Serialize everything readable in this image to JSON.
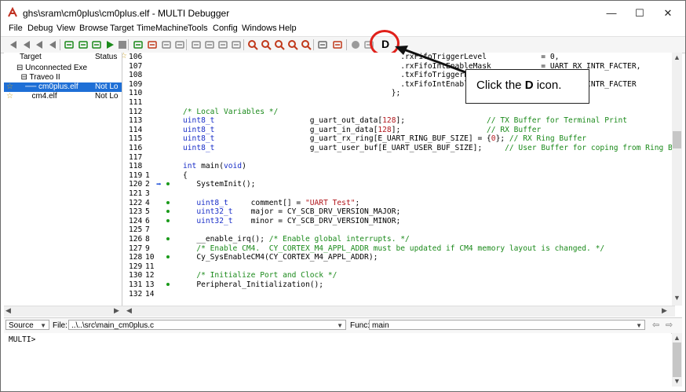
{
  "window": {
    "title": "ghs\\sram\\cm0plus\\cm0plus.elf - MULTI Debugger",
    "minimize_glyph": "—",
    "maximize_glyph": "☐",
    "close_glyph": "✕"
  },
  "menu": [
    "File",
    "Debug",
    "View",
    "Browse",
    "Target",
    "TimeMachine",
    "Tools",
    "Config",
    "Windows",
    "Help"
  ],
  "toolbar": {
    "d_button_label": "D",
    "icons": [
      "back-icon",
      "step-back-icon",
      "step-back2-icon",
      "step-back3-icon",
      "step-over-icon",
      "step-into-icon",
      "step-out-icon",
      "run-icon",
      "stop-icon",
      "restart-icon",
      "download-icon",
      "breakpoint-icon",
      "trace-icon",
      "memory-icon",
      "registers-icon",
      "call-stack-icon",
      "profile-icon",
      "zoom1-icon",
      "zoom2-icon",
      "zoom3-icon",
      "zoom4-icon",
      "zoom5-icon",
      "windows-icon",
      "calc-icon",
      "hand-icon",
      "record-icon"
    ]
  },
  "target_panel": {
    "header_target": "Target",
    "header_status": "Status",
    "rows": [
      {
        "label": "⊟ Unconnected Exe",
        "status": ""
      },
      {
        "label": "  ⊟ Traveo II",
        "status": ""
      },
      {
        "label": "    ── cm0plus.elf",
        "status": "Not Lo",
        "selected": true
      },
      {
        "label": "       cm4.elf",
        "status": "Not Lo",
        "selected": false
      }
    ]
  },
  "source_lines": [
    {
      "ln": "106",
      "ln2": "",
      "dot": false,
      "parts": [
        {
          "t": "                                                .rxFifoTriggerLevel            = 0,",
          "c": ""
        }
      ]
    },
    {
      "ln": "107",
      "ln2": "",
      "dot": false,
      "parts": [
        {
          "t": "                                                .rxFifoIntEnableMask           = UART_RX_INTR_FACTER,",
          "c": ""
        }
      ]
    },
    {
      "ln": "108",
      "ln2": "",
      "dot": false,
      "parts": [
        {
          "t": "                                                .txFifoTriggerLevel",
          "c": ""
        }
      ]
    },
    {
      "ln": "109",
      "ln2": "",
      "dot": false,
      "parts": [
        {
          "t": "                                                .txFifoIntEnableMask           = UART_TX_INTR_FACTER",
          "c": ""
        }
      ]
    },
    {
      "ln": "110",
      "ln2": "",
      "dot": false,
      "parts": [
        {
          "t": "                                              };",
          "c": ""
        }
      ]
    },
    {
      "ln": "111",
      "ln2": "",
      "dot": false,
      "parts": [
        {
          "t": "",
          "c": ""
        }
      ]
    },
    {
      "ln": "112",
      "ln2": "",
      "dot": false,
      "parts": [
        {
          "t": "/* Local Variables */",
          "c": "cm"
        }
      ]
    },
    {
      "ln": "113",
      "ln2": "",
      "dot": false,
      "parts": [
        {
          "t": "uint8_t",
          "c": "kw"
        },
        {
          "t": "                     g_uart_out_data[",
          "c": ""
        },
        {
          "t": "128",
          "c": "st"
        },
        {
          "t": "];                  ",
          "c": ""
        },
        {
          "t": "// TX Buffer for Terminal Print",
          "c": "cm"
        }
      ]
    },
    {
      "ln": "114",
      "ln2": "",
      "dot": false,
      "parts": [
        {
          "t": "uint8_t",
          "c": "kw"
        },
        {
          "t": "                     g_uart_in_data[",
          "c": ""
        },
        {
          "t": "128",
          "c": "st"
        },
        {
          "t": "];                   ",
          "c": ""
        },
        {
          "t": "// RX Buffer",
          "c": "cm"
        }
      ]
    },
    {
      "ln": "115",
      "ln2": "",
      "dot": false,
      "parts": [
        {
          "t": "uint8_t",
          "c": "kw"
        },
        {
          "t": "                     g_uart_rx_ring[E_UART_RING_BUF_SIZE] = {",
          "c": ""
        },
        {
          "t": "0",
          "c": "st"
        },
        {
          "t": "}; ",
          "c": ""
        },
        {
          "t": "// RX Ring Buffer",
          "c": "cm"
        }
      ]
    },
    {
      "ln": "116",
      "ln2": "",
      "dot": false,
      "parts": [
        {
          "t": "uint8_t",
          "c": "kw"
        },
        {
          "t": "                     g_uart_user_buf[E_UART_USER_BUF_SIZE];     ",
          "c": ""
        },
        {
          "t": "// User Buffer for coping from Ring Buffer",
          "c": "cm"
        }
      ]
    },
    {
      "ln": "117",
      "ln2": "",
      "dot": false,
      "parts": [
        {
          "t": "",
          "c": ""
        }
      ]
    },
    {
      "ln": "118",
      "ln2": "",
      "dot": false,
      "parts": [
        {
          "t": "int",
          "c": "kw"
        },
        {
          "t": " main(",
          "c": ""
        },
        {
          "t": "void",
          "c": "kw"
        },
        {
          "t": ")",
          "c": ""
        }
      ]
    },
    {
      "ln": "119",
      "ln2": "1",
      "dot": false,
      "parts": [
        {
          "t": "{",
          "c": ""
        }
      ]
    },
    {
      "ln": "120",
      "ln2": "2",
      "dot": true,
      "pc": true,
      "parts": [
        {
          "t": "   SystemInit();",
          "c": ""
        }
      ]
    },
    {
      "ln": "121",
      "ln2": "3",
      "dot": false,
      "parts": [
        {
          "t": "",
          "c": ""
        }
      ]
    },
    {
      "ln": "122",
      "ln2": "4",
      "dot": true,
      "parts": [
        {
          "t": "   ",
          "c": ""
        },
        {
          "t": "uint8_t",
          "c": "kw"
        },
        {
          "t": "     comment[] = ",
          "c": ""
        },
        {
          "t": "\"UART Test\"",
          "c": "st"
        },
        {
          "t": ";",
          "c": ""
        }
      ]
    },
    {
      "ln": "123",
      "ln2": "5",
      "dot": true,
      "parts": [
        {
          "t": "   ",
          "c": ""
        },
        {
          "t": "uint32_t",
          "c": "kw"
        },
        {
          "t": "    major = CY_SCB_DRV_VERSION_MAJOR;",
          "c": ""
        }
      ]
    },
    {
      "ln": "124",
      "ln2": "6",
      "dot": true,
      "parts": [
        {
          "t": "   ",
          "c": ""
        },
        {
          "t": "uint32_t",
          "c": "kw"
        },
        {
          "t": "    minor = CY_SCB_DRV_VERSION_MINOR;",
          "c": ""
        }
      ]
    },
    {
      "ln": "125",
      "ln2": "7",
      "dot": false,
      "parts": [
        {
          "t": "",
          "c": ""
        }
      ]
    },
    {
      "ln": "126",
      "ln2": "8",
      "dot": true,
      "parts": [
        {
          "t": "   __enable_irq(); ",
          "c": ""
        },
        {
          "t": "/* Enable global interrupts. */",
          "c": "cm"
        }
      ]
    },
    {
      "ln": "127",
      "ln2": "9",
      "dot": false,
      "parts": [
        {
          "t": "   ",
          "c": ""
        },
        {
          "t": "/* Enable CM4.  CY_CORTEX_M4_APPL_ADDR must be updated if CM4 memory layout is changed. */",
          "c": "cm"
        }
      ]
    },
    {
      "ln": "128",
      "ln2": "10",
      "dot": true,
      "parts": [
        {
          "t": "   Cy_SysEnableCM4(CY_CORTEX_M4_APPL_ADDR);",
          "c": ""
        }
      ]
    },
    {
      "ln": "129",
      "ln2": "11",
      "dot": false,
      "parts": [
        {
          "t": "",
          "c": ""
        }
      ]
    },
    {
      "ln": "130",
      "ln2": "12",
      "dot": false,
      "parts": [
        {
          "t": "   ",
          "c": ""
        },
        {
          "t": "/* Initialize Port and Clock */",
          "c": "cm"
        }
      ]
    },
    {
      "ln": "131",
      "ln2": "13",
      "dot": true,
      "parts": [
        {
          "t": "   Peripheral_Initialization();",
          "c": ""
        }
      ]
    },
    {
      "ln": "132",
      "ln2": "14",
      "dot": false,
      "parts": [
        {
          "t": "",
          "c": ""
        }
      ]
    }
  ],
  "source_bar": {
    "source_select": "Source",
    "file_label": "File:",
    "file_value": "..\\..\\src\\main_cm0plus.c",
    "func_label": "Func:",
    "func_value": "main"
  },
  "command_pane": {
    "prompt": "MULTI>"
  },
  "callout": {
    "prefix": "Click the ",
    "bold": "D",
    "suffix": " icon."
  },
  "colors": {
    "highlight_circle": "#e0201a",
    "selection": "#1e6fd6",
    "keyword": "#1a2fc8",
    "comment": "#1b8a1b",
    "literal": "#b1171d"
  }
}
